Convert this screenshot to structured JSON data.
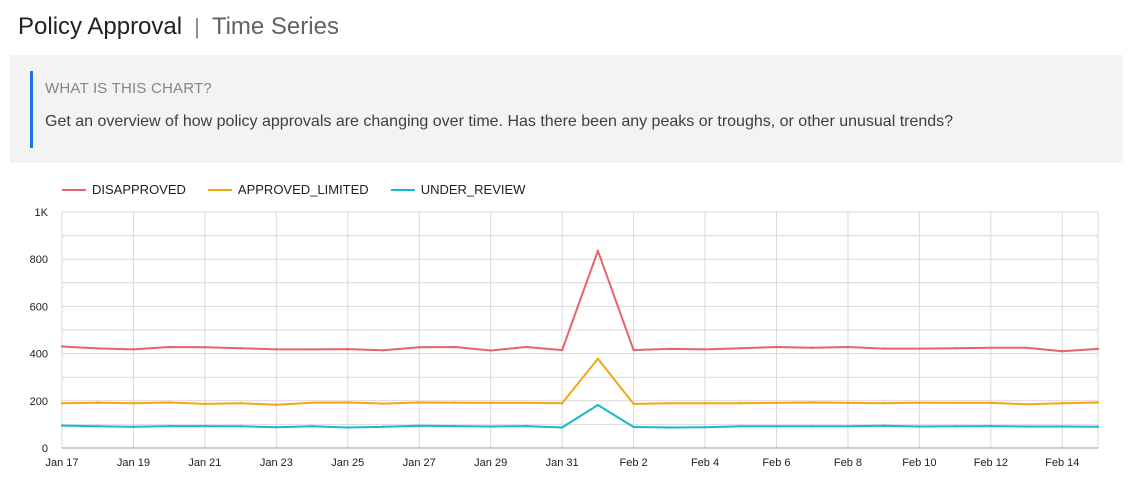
{
  "header": {
    "title": "Policy Approval",
    "separator": "|",
    "subtitle": "Time Series"
  },
  "info": {
    "heading": "WHAT IS THIS CHART?",
    "text": "Get an overview of how policy approvals are changing over time. Has there been any peaks or troughs, or other unusual trends?"
  },
  "colors": {
    "accent_bar": "#1a73e8",
    "grid": "#d9d9d9"
  },
  "chart_data": {
    "type": "line",
    "x": [
      "Jan 17",
      "Jan 18",
      "Jan 19",
      "Jan 20",
      "Jan 21",
      "Jan 22",
      "Jan 23",
      "Jan 24",
      "Jan 25",
      "Jan 26",
      "Jan 27",
      "Jan 28",
      "Jan 29",
      "Jan 30",
      "Jan 31",
      "Feb 1",
      "Feb 2",
      "Feb 3",
      "Feb 4",
      "Feb 5",
      "Feb 6",
      "Feb 7",
      "Feb 8",
      "Feb 9",
      "Feb 10",
      "Feb 11",
      "Feb 12",
      "Feb 13",
      "Feb 14",
      "Feb 15"
    ],
    "x_tick_labels": [
      "Jan 17",
      "Jan 19",
      "Jan 21",
      "Jan 23",
      "Jan 25",
      "Jan 27",
      "Jan 29",
      "Jan 31",
      "Feb 2",
      "Feb 4",
      "Feb 6",
      "Feb 8",
      "Feb 10",
      "Feb 12",
      "Feb 14"
    ],
    "y_tick_labels": [
      "0",
      "200",
      "400",
      "600",
      "800",
      "1K"
    ],
    "ylim": [
      0,
      1000
    ],
    "grid": true,
    "legend_position": "top-left",
    "series": [
      {
        "name": "DISAPPROVED",
        "color": "#e8636b",
        "values": [
          430,
          422,
          418,
          428,
          427,
          423,
          418,
          418,
          419,
          414,
          427,
          428,
          413,
          428,
          415,
          835,
          415,
          420,
          418,
          423,
          428,
          425,
          428,
          421,
          421,
          423,
          425,
          425,
          410,
          420
        ]
      },
      {
        "name": "APPROVED_LIMITED",
        "color": "#f3a712",
        "values": [
          190,
          192,
          190,
          193,
          187,
          190,
          183,
          192,
          193,
          188,
          193,
          192,
          191,
          191,
          190,
          378,
          187,
          190,
          190,
          190,
          191,
          193,
          191,
          190,
          192,
          191,
          191,
          185,
          190,
          193
        ]
      },
      {
        "name": "UNDER_REVIEW",
        "color": "#1bb7cc",
        "values": [
          95,
          92,
          90,
          93,
          93,
          92,
          88,
          92,
          87,
          90,
          94,
          93,
          91,
          93,
          87,
          182,
          89,
          87,
          88,
          92,
          92,
          92,
          92,
          94,
          91,
          92,
          93,
          91,
          91,
          90
        ]
      }
    ]
  }
}
